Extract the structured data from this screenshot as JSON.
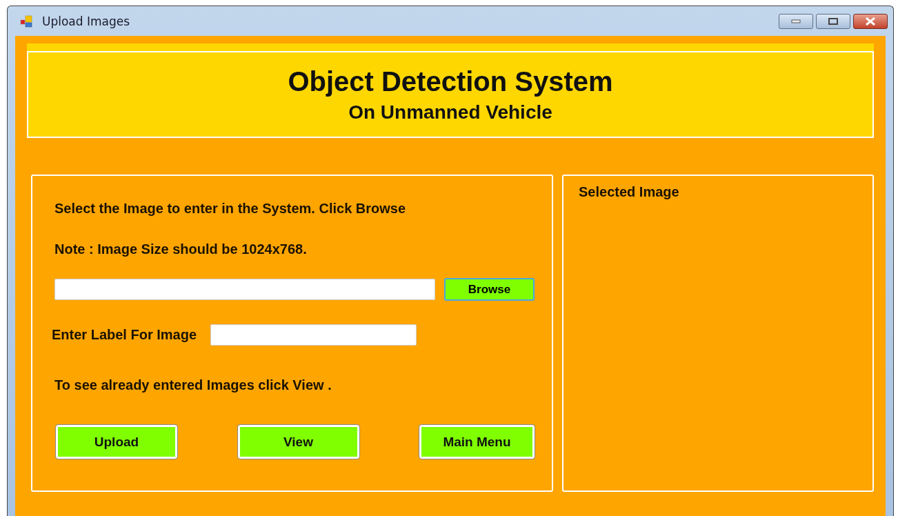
{
  "window": {
    "title": "Upload Images"
  },
  "header": {
    "title": "Object Detection System",
    "subtitle": "On Unmanned Vehicle"
  },
  "upload_panel": {
    "instruction": "Select the Image to enter in the System. Click Browse",
    "note": "Note : Image Size should be 1024x768.",
    "browse_button": "Browse",
    "label_prompt": "Enter Label For Image",
    "view_hint": "To see already entered Images click View .",
    "buttons": [
      "Upload",
      "View",
      "Main Menu"
    ]
  },
  "preview_panel": {
    "title": "Selected Image"
  }
}
